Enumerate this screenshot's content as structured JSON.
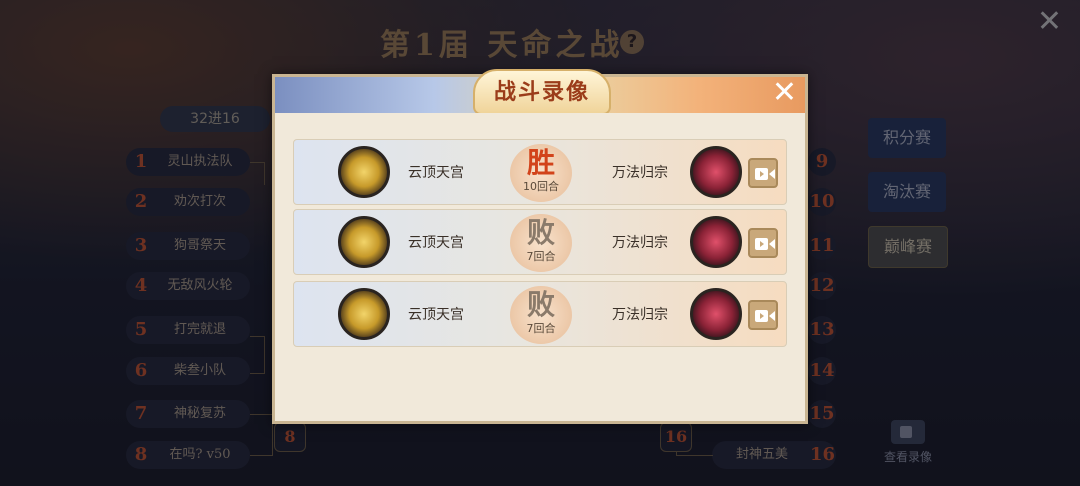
{
  "background": {
    "title": "第1届 天命之战",
    "help_icon": "?",
    "close_icon": "✕",
    "stage_label": "32进16",
    "left_teams": [
      {
        "num": "1",
        "name": "灵山执法队"
      },
      {
        "num": "2",
        "name": "劝次打次"
      },
      {
        "num": "3",
        "name": "狗哥祭天"
      },
      {
        "num": "4",
        "name": "无敌风火轮"
      },
      {
        "num": "5",
        "name": "打完就退"
      },
      {
        "num": "6",
        "name": "柴叁小队"
      },
      {
        "num": "7",
        "name": "神秘复苏"
      },
      {
        "num": "8",
        "name": "在吗? v50"
      }
    ],
    "node_left": "8",
    "node_right": "16",
    "right_nums": [
      "9",
      "10",
      "11",
      "12",
      "13",
      "14",
      "15",
      "16"
    ],
    "right_team_16_name": "封神五美",
    "tabs": [
      {
        "label": "积分赛",
        "active": false
      },
      {
        "label": "淘汰赛",
        "active": false
      },
      {
        "label": "巅峰赛",
        "active": true
      }
    ],
    "view_replay_label": "查看录像"
  },
  "dialog": {
    "title": "战斗录像",
    "records": [
      {
        "left_team": "云顶天宫",
        "right_team": "万法归宗",
        "result": "胜",
        "rounds": "10回合",
        "outcome": "win"
      },
      {
        "left_team": "云顶天宫",
        "right_team": "万法归宗",
        "result": "败",
        "rounds": "7回合",
        "outcome": "lose"
      },
      {
        "left_team": "云顶天宫",
        "right_team": "万法归宗",
        "result": "败",
        "rounds": "7回合",
        "outcome": "lose"
      }
    ]
  },
  "colors": {
    "win": "#d2431a",
    "lose": "#8a7a6a",
    "accent": "#c0502c"
  }
}
